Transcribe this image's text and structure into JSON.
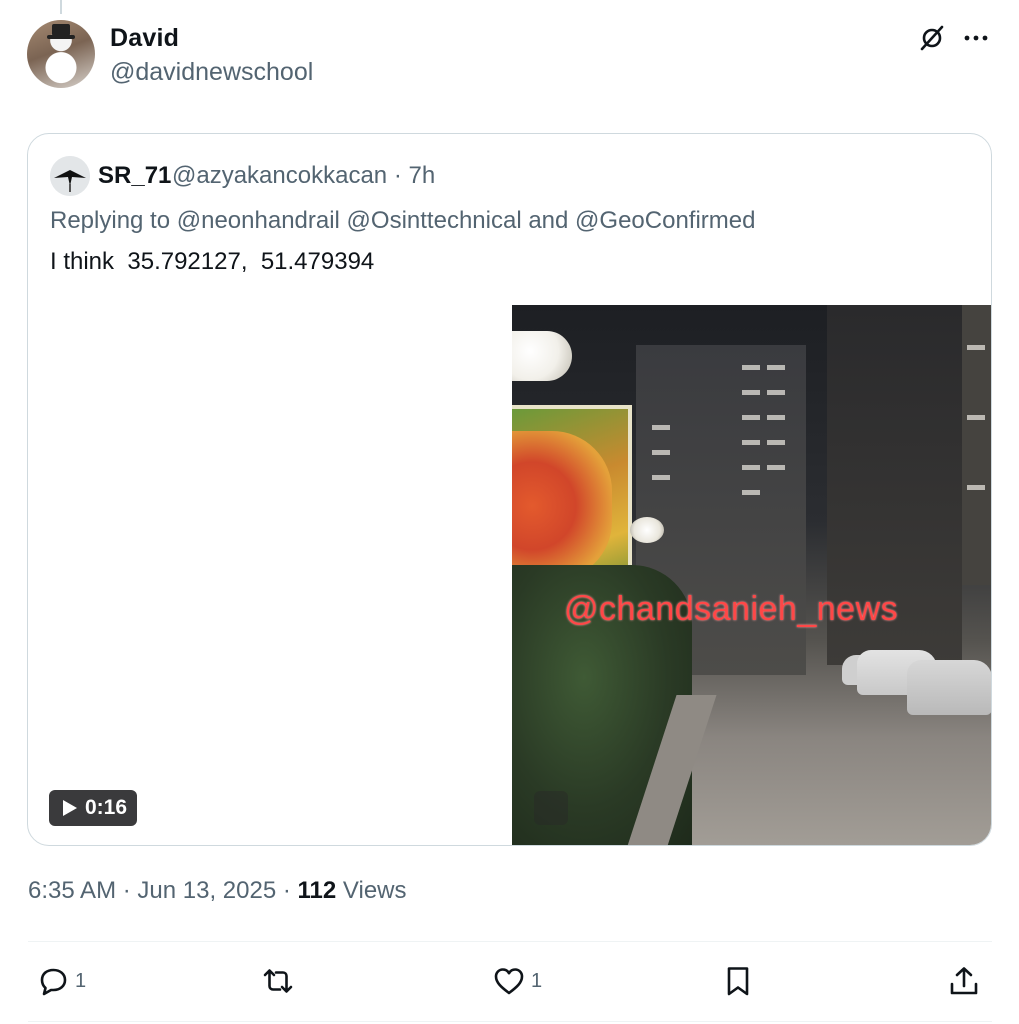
{
  "tweet": {
    "author_name": "David",
    "author_handle": "@davidnewschool",
    "timestamp": "6:35 AM · Jun 13, 2025",
    "views_count": "112",
    "views_label": "Views"
  },
  "quote": {
    "author_name": "SR_71",
    "author_handle_time": "@azyakancokkacan · 7h",
    "replying_to": "Replying to @neonhandrail @Osinttechnical and @GeoConfirmed",
    "text": "I think  35.792127,  51.479394",
    "video": {
      "duration": "0:16",
      "watermark": "@chandsanieh_news"
    }
  },
  "actions": {
    "reply_count": "1",
    "like_count": "1"
  },
  "icons": {
    "top_right": [
      "grok-icon",
      "more-icon"
    ],
    "bar": [
      "reply-icon",
      "retweet-icon",
      "like-icon",
      "bookmark-icon",
      "share-icon"
    ]
  },
  "colors": {
    "text_primary": "#0f1419",
    "text_secondary": "#536471",
    "border": "#cfd9de",
    "watermark": "#ff4747"
  }
}
